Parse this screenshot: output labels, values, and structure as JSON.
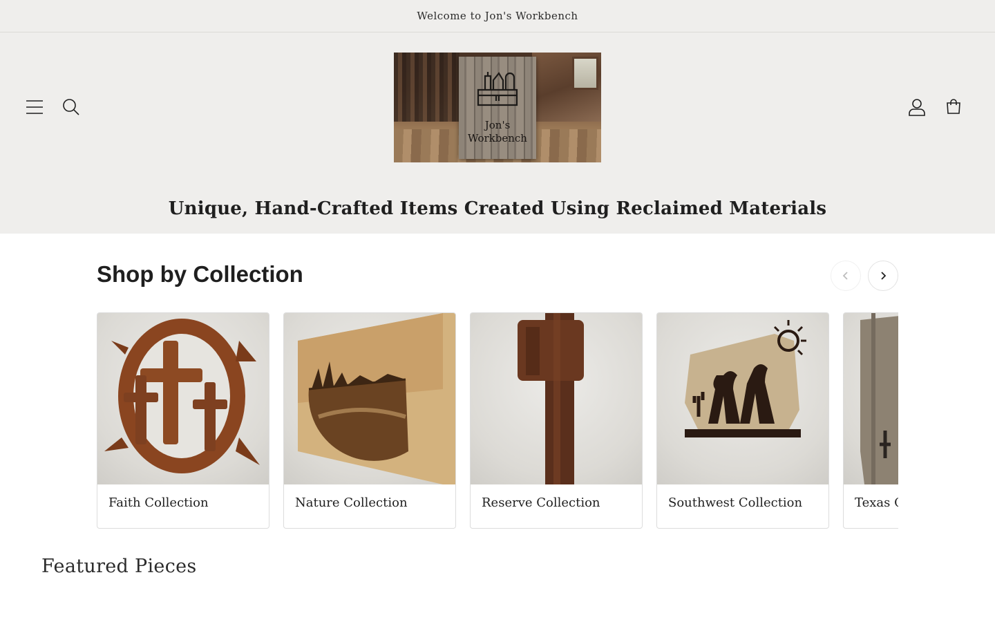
{
  "announcement": {
    "text": "Welcome to Jon's Workbench"
  },
  "header": {
    "logo_text_line1": "Jon's",
    "logo_text_line2": "Workbench",
    "tagline": "Unique, Hand-Crafted Items Created Using Reclaimed Materials",
    "icons": [
      "menu-icon",
      "search-icon",
      "account-icon",
      "cart-icon"
    ]
  },
  "collections": {
    "title": "Shop by Collection",
    "prev_label": "Slide left",
    "next_label": "Slide right",
    "items": [
      {
        "label": "Faith Collection"
      },
      {
        "label": "Nature Collection"
      },
      {
        "label": "Reserve Collection"
      },
      {
        "label": "Southwest Collection"
      },
      {
        "label": "Texas Collection"
      }
    ]
  },
  "featured": {
    "title": "Featured Pieces"
  },
  "colors": {
    "header_bg": "#efeeec",
    "border": "#dcdcdc",
    "text": "#1f1f1f"
  }
}
